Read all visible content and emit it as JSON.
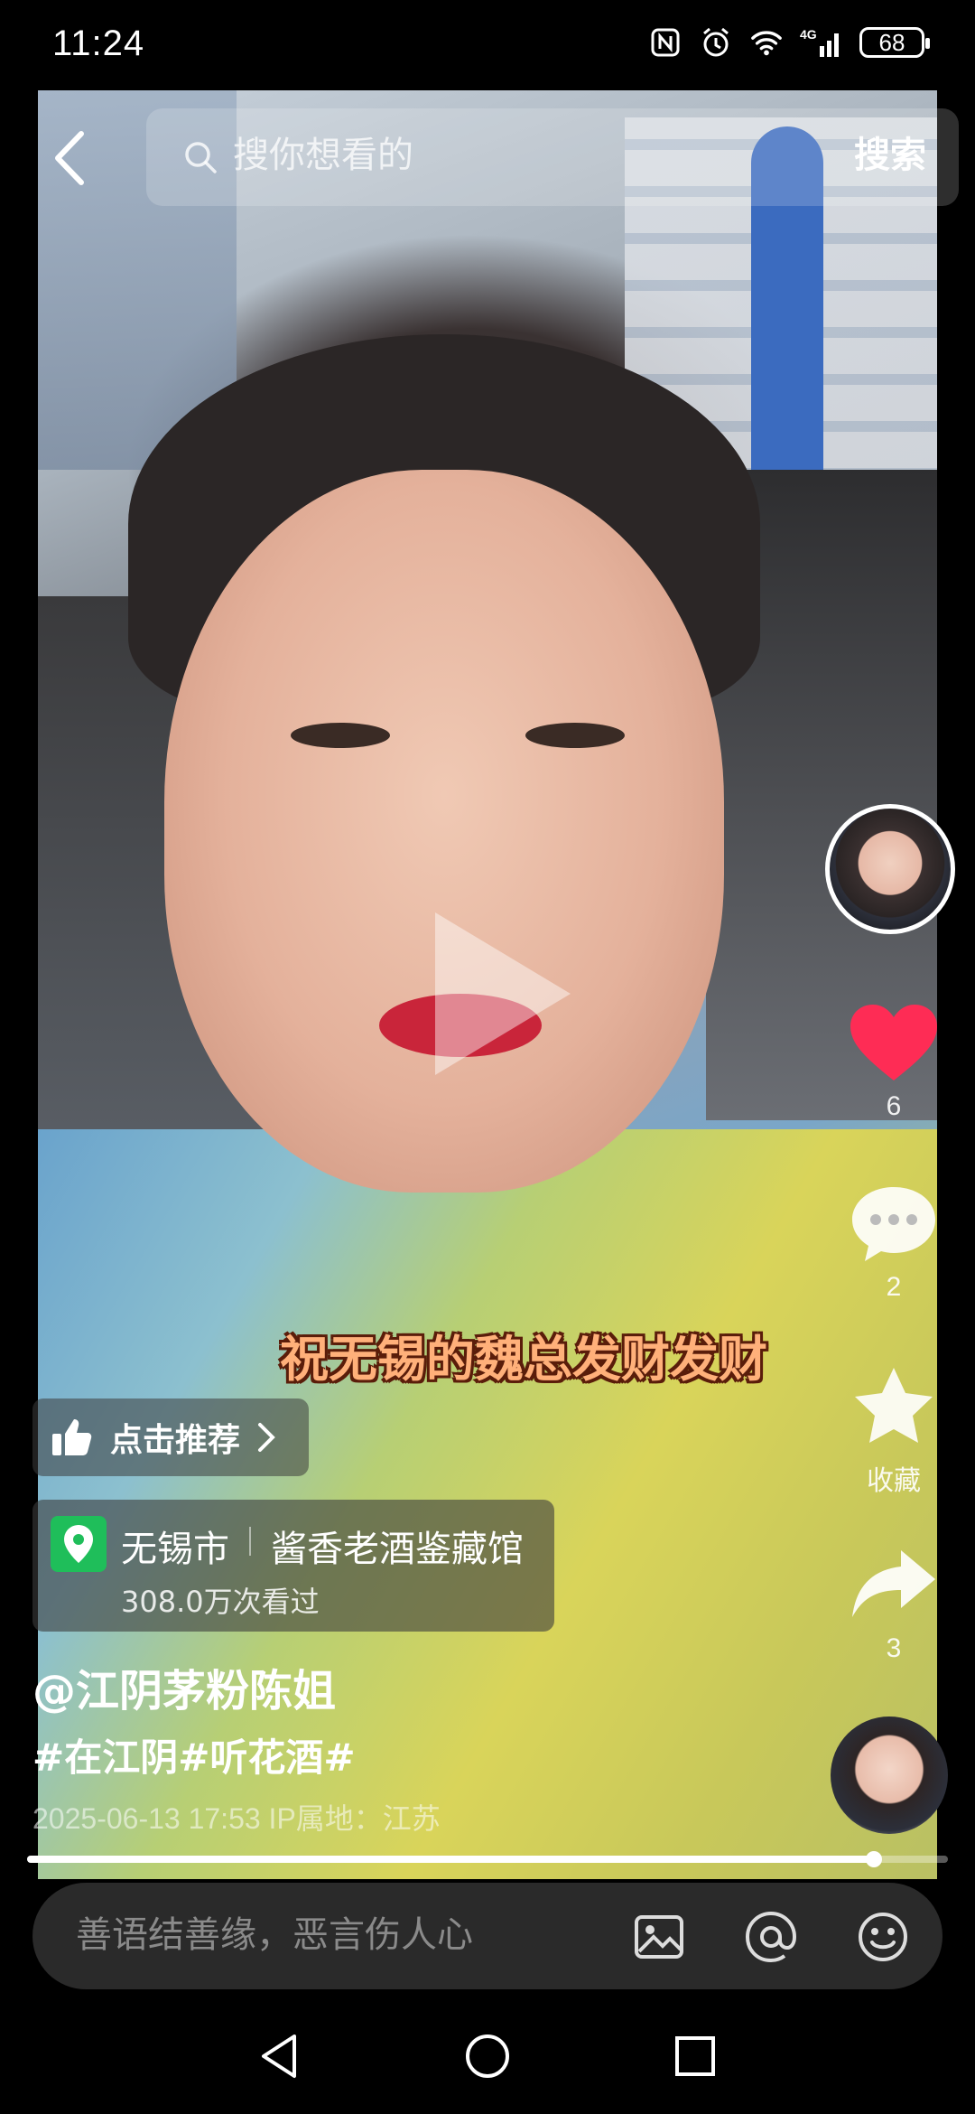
{
  "status": {
    "time": "11:24",
    "battery": "68",
    "network": "4G"
  },
  "search": {
    "placeholder": "搜你想看的",
    "button": "搜索"
  },
  "video": {
    "subtitle": "祝无锡的魏总发财发财",
    "progress": 0.92
  },
  "actions": {
    "likes": "6",
    "comments": "2",
    "favorite_label": "收藏",
    "shares": "3"
  },
  "recommend": {
    "label": "点击推荐"
  },
  "location": {
    "city": "无锡市",
    "venue": "酱香老酒鉴藏馆",
    "views": "308.0万次看过"
  },
  "post": {
    "author": "@江阴茅粉陈姐",
    "tags": "#在江阴#听花酒#",
    "meta": "2025-06-13 17:53  IP属地：江苏"
  },
  "comment": {
    "placeholder": "善语结善缘，恶言伤人心"
  },
  "colors": {
    "like": "#fe2c55",
    "location_pin": "#1fbe5a"
  }
}
